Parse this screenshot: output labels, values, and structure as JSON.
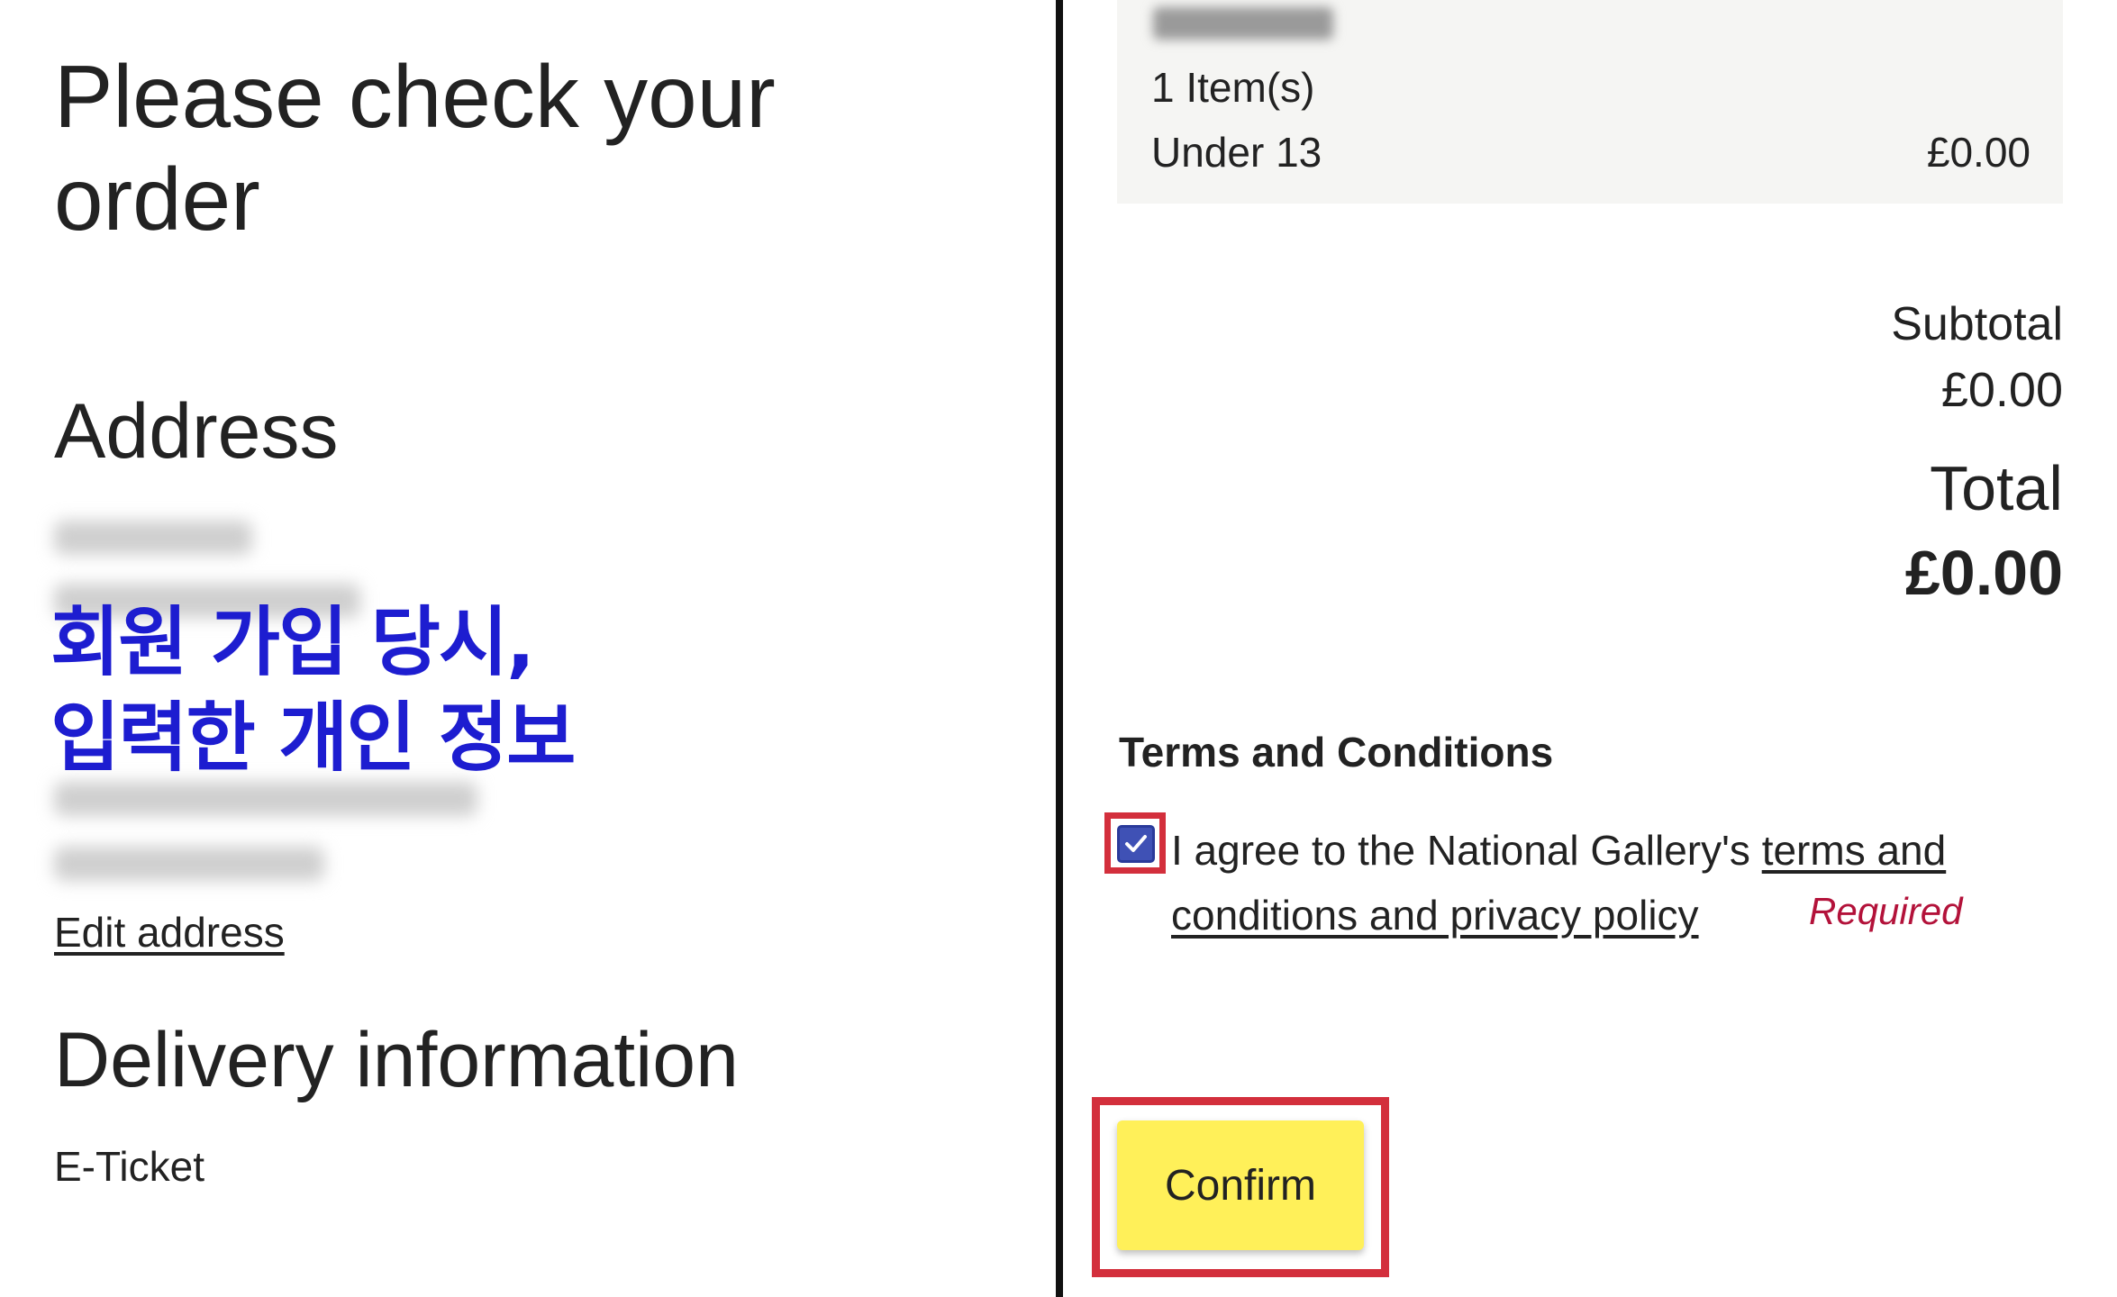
{
  "left": {
    "page_title": "Please check your order",
    "address_heading": "Address",
    "annotation_line1": "회원 가입 당시,",
    "annotation_line2": "입력한 개인 정보",
    "edit_address": "Edit address",
    "delivery_heading": "Delivery information",
    "delivery_value": "E-Ticket"
  },
  "order": {
    "items_count": "1 Item(s)",
    "ticket_type": "Under 13",
    "ticket_price": "£0.00"
  },
  "summary": {
    "subtotal_label": "Subtotal",
    "subtotal_value": "£0.00",
    "total_label": "Total",
    "total_value": "£0.00"
  },
  "terms": {
    "heading": "Terms and Conditions",
    "agree_prefix": "I agree to the National Gallery's ",
    "link_text": "terms and conditions and privacy policy",
    "required": "Required",
    "checked": true
  },
  "actions": {
    "confirm": "Confirm"
  },
  "colors": {
    "annotation": "#1d1dd0",
    "highlight": "#d32f3c",
    "confirm_bg": "#fff059",
    "checkbox": "#3f51b5",
    "required": "#b3123a"
  },
  "icons": {
    "checkbox": "checkmark-icon"
  }
}
